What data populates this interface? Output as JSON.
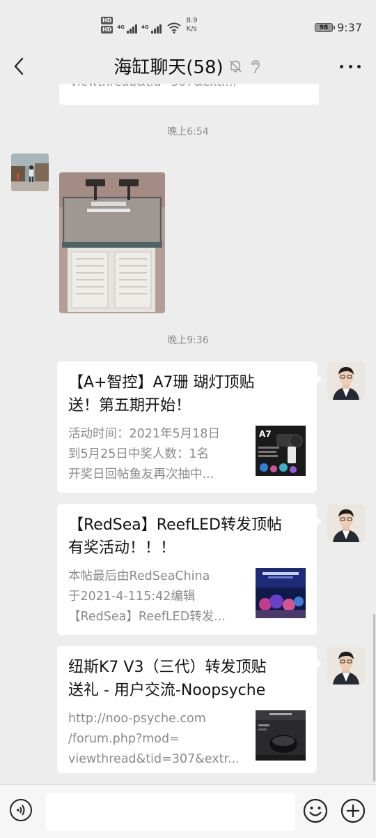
{
  "status_bar": {
    "hd1": "HD",
    "hd2": "HD",
    "net1": "4G",
    "net2": "4G",
    "speed_value": "8.9",
    "speed_unit": "K/s",
    "battery": "98",
    "time": "9:37"
  },
  "header": {
    "title": "海缸聊天(58)",
    "icons": [
      "back-arrow-icon",
      "mute-bell-icon",
      "ear-icon",
      "more-icon"
    ]
  },
  "chat": {
    "partial_card_text": "viewthread&tid=307&extr...",
    "timestamp_1": "晚上6:54",
    "timestamp_2": "晚上9:36",
    "cards": [
      {
        "title_line1": "【A+智控】A7珊 瑚灯顶贴",
        "title_line2": "送！第五期开始！",
        "desc": [
          "活动时间：2021年5月18日",
          "到5月25日中奖人数：1名",
          "开奖日回帖鱼友再次抽中..."
        ],
        "thumb_label": "A7"
      },
      {
        "title_line1": "【RedSea】ReefLED转发顶帖",
        "title_line2": "有奖活动！！！",
        "desc": [
          "本帖最后由RedSeaChina",
          "于2021-4-115:42编辑",
          "【RedSea】ReefLED转发..."
        ]
      },
      {
        "title_line1": "纽斯K7 V3（三代）转发顶贴",
        "title_line2": "送礼 - 用户交流-Noopsyche",
        "desc": [
          "http://noo-psyche.com",
          "/forum.php?mod=",
          "viewthread&tid=307&extr..."
        ]
      }
    ]
  },
  "input_bar": {
    "placeholder": "",
    "icons": [
      "voice-icon",
      "emoji-icon",
      "plus-icon"
    ]
  },
  "colors": {
    "background": "#ededed",
    "bubble": "#ffffff",
    "timestamp": "#8f8f8f",
    "desc": "#8a8a8a"
  }
}
